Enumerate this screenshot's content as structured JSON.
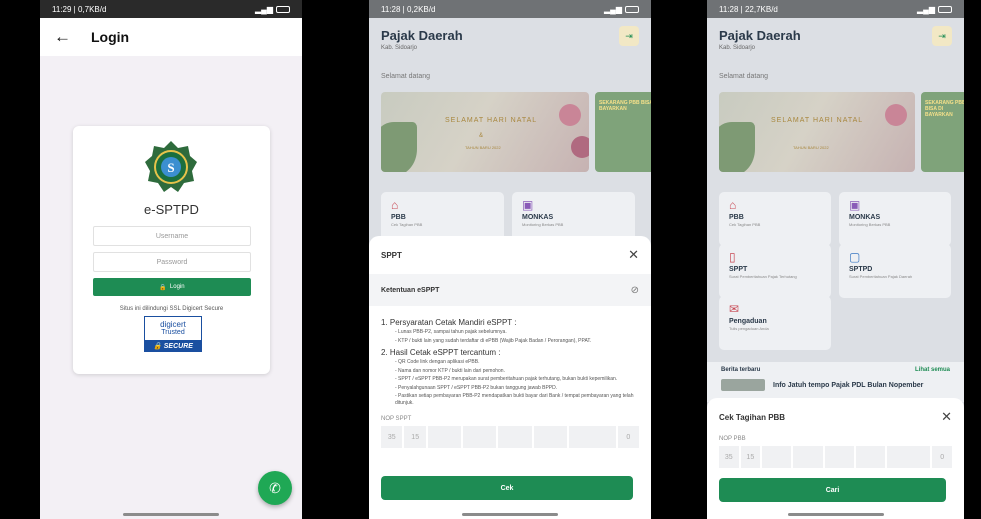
{
  "screen1": {
    "status_left": "11:29 | 0,7KB/d",
    "title": "Login",
    "app_name": "e-SPTPD",
    "username_placeholder": "Username",
    "password_placeholder": "Password",
    "login_label": "Login",
    "ssl_text": "Situs ini dilindungi SSL Digicert Secure",
    "seal_brand": "digicert",
    "seal_trusted": "Trusted",
    "seal_secure": "SECURE",
    "colors": {
      "primary": "#1e8c54",
      "background": "#f3f0f5"
    }
  },
  "screen2": {
    "status_left": "11:28 | 0,2KB/d",
    "title": "Pajak Daerah",
    "subtitle": "Kab. Sidoarjo",
    "welcome": "Selamat datang",
    "banner_title": "SELAMAT HARI NATAL",
    "banner_amp": "&",
    "banner_sub": "TAHUN BARU 2022",
    "banner2_text": "SEKARANG PBB BISA DI BAYARKAN",
    "menu": [
      {
        "title": "PBB",
        "sub": "Cek Tagihan PBB"
      },
      {
        "title": "MONKAS",
        "sub": "Monitoring Berkas PBB"
      }
    ],
    "sheet": {
      "title": "SPPT",
      "subtitle": "Ketentuan eSPPT",
      "h1": "1. Persyaratan Cetak Mandiri eSPPT :",
      "items1": [
        "- Lunas PBB-P2, sampai tahun pajak sebelumnya.",
        "- KTP / bukti lain yang sudah terdaftar di ePBB (Wajib Pajak Badan / Perorangan), PPAT."
      ],
      "h2": "2. Hasil Cetak eSPPT tercantum :",
      "items2": [
        "- QR Code link dengan aplikasi ePBB.",
        "- Nama dan nomor KTP / bukti lain dari pemohon.",
        "- SPPT / eSPPT PBB-P2 merupakan surat pemberitahuan pajak terhutang, bukan bukti kepemilikan.",
        "- Penyalahgunaan SPPT / eSPPT PBB-P2 bukan tanggung jawab BPPD.",
        "- Pastikan setiap pembayaran PBB-P2 mendapatkan bukti bayar dari Bank / tempat pembayaran yang telah ditunjuk."
      ],
      "nop_label": "NOP SPPT",
      "nop_values": [
        "35",
        "15",
        "",
        "",
        "",
        "",
        "",
        "0"
      ],
      "button": "Cek"
    }
  },
  "screen3": {
    "status_left": "11:28 | 22,7KB/d",
    "title": "Pajak Daerah",
    "subtitle": "Kab. Sidoarjo",
    "welcome": "Selamat datang",
    "banner_title": "SELAMAT HARI NATAL",
    "banner_sub": "TAHUN BARU 2022",
    "banner2_text": "SEKARANG PBB BISA DI BAYARKAN",
    "menu": [
      {
        "title": "PBB",
        "sub": "Cek Tagihan PBB"
      },
      {
        "title": "MONKAS",
        "sub": "Monitoring Berkas PBB"
      },
      {
        "title": "SPPT",
        "sub": "Surat Pemberitahuan Pajak Terhutang"
      },
      {
        "title": "SPTPD",
        "sub": "Surat Pemberitahuan Pajak Daerah"
      },
      {
        "title": "Pengaduan",
        "sub": "Tulis pengaduan Anda"
      }
    ],
    "news_title": "Berita terbaru",
    "news_more": "Lihat semua",
    "news_item": "Info Jatuh tempo Pajak PDL Bulan Nopember",
    "sheet": {
      "title": "Cek Tagihan PBB",
      "nop_label": "NOP PBB",
      "nop_values": [
        "35",
        "15",
        "",
        "",
        "",
        "",
        "",
        "0"
      ],
      "button": "Cari"
    }
  }
}
